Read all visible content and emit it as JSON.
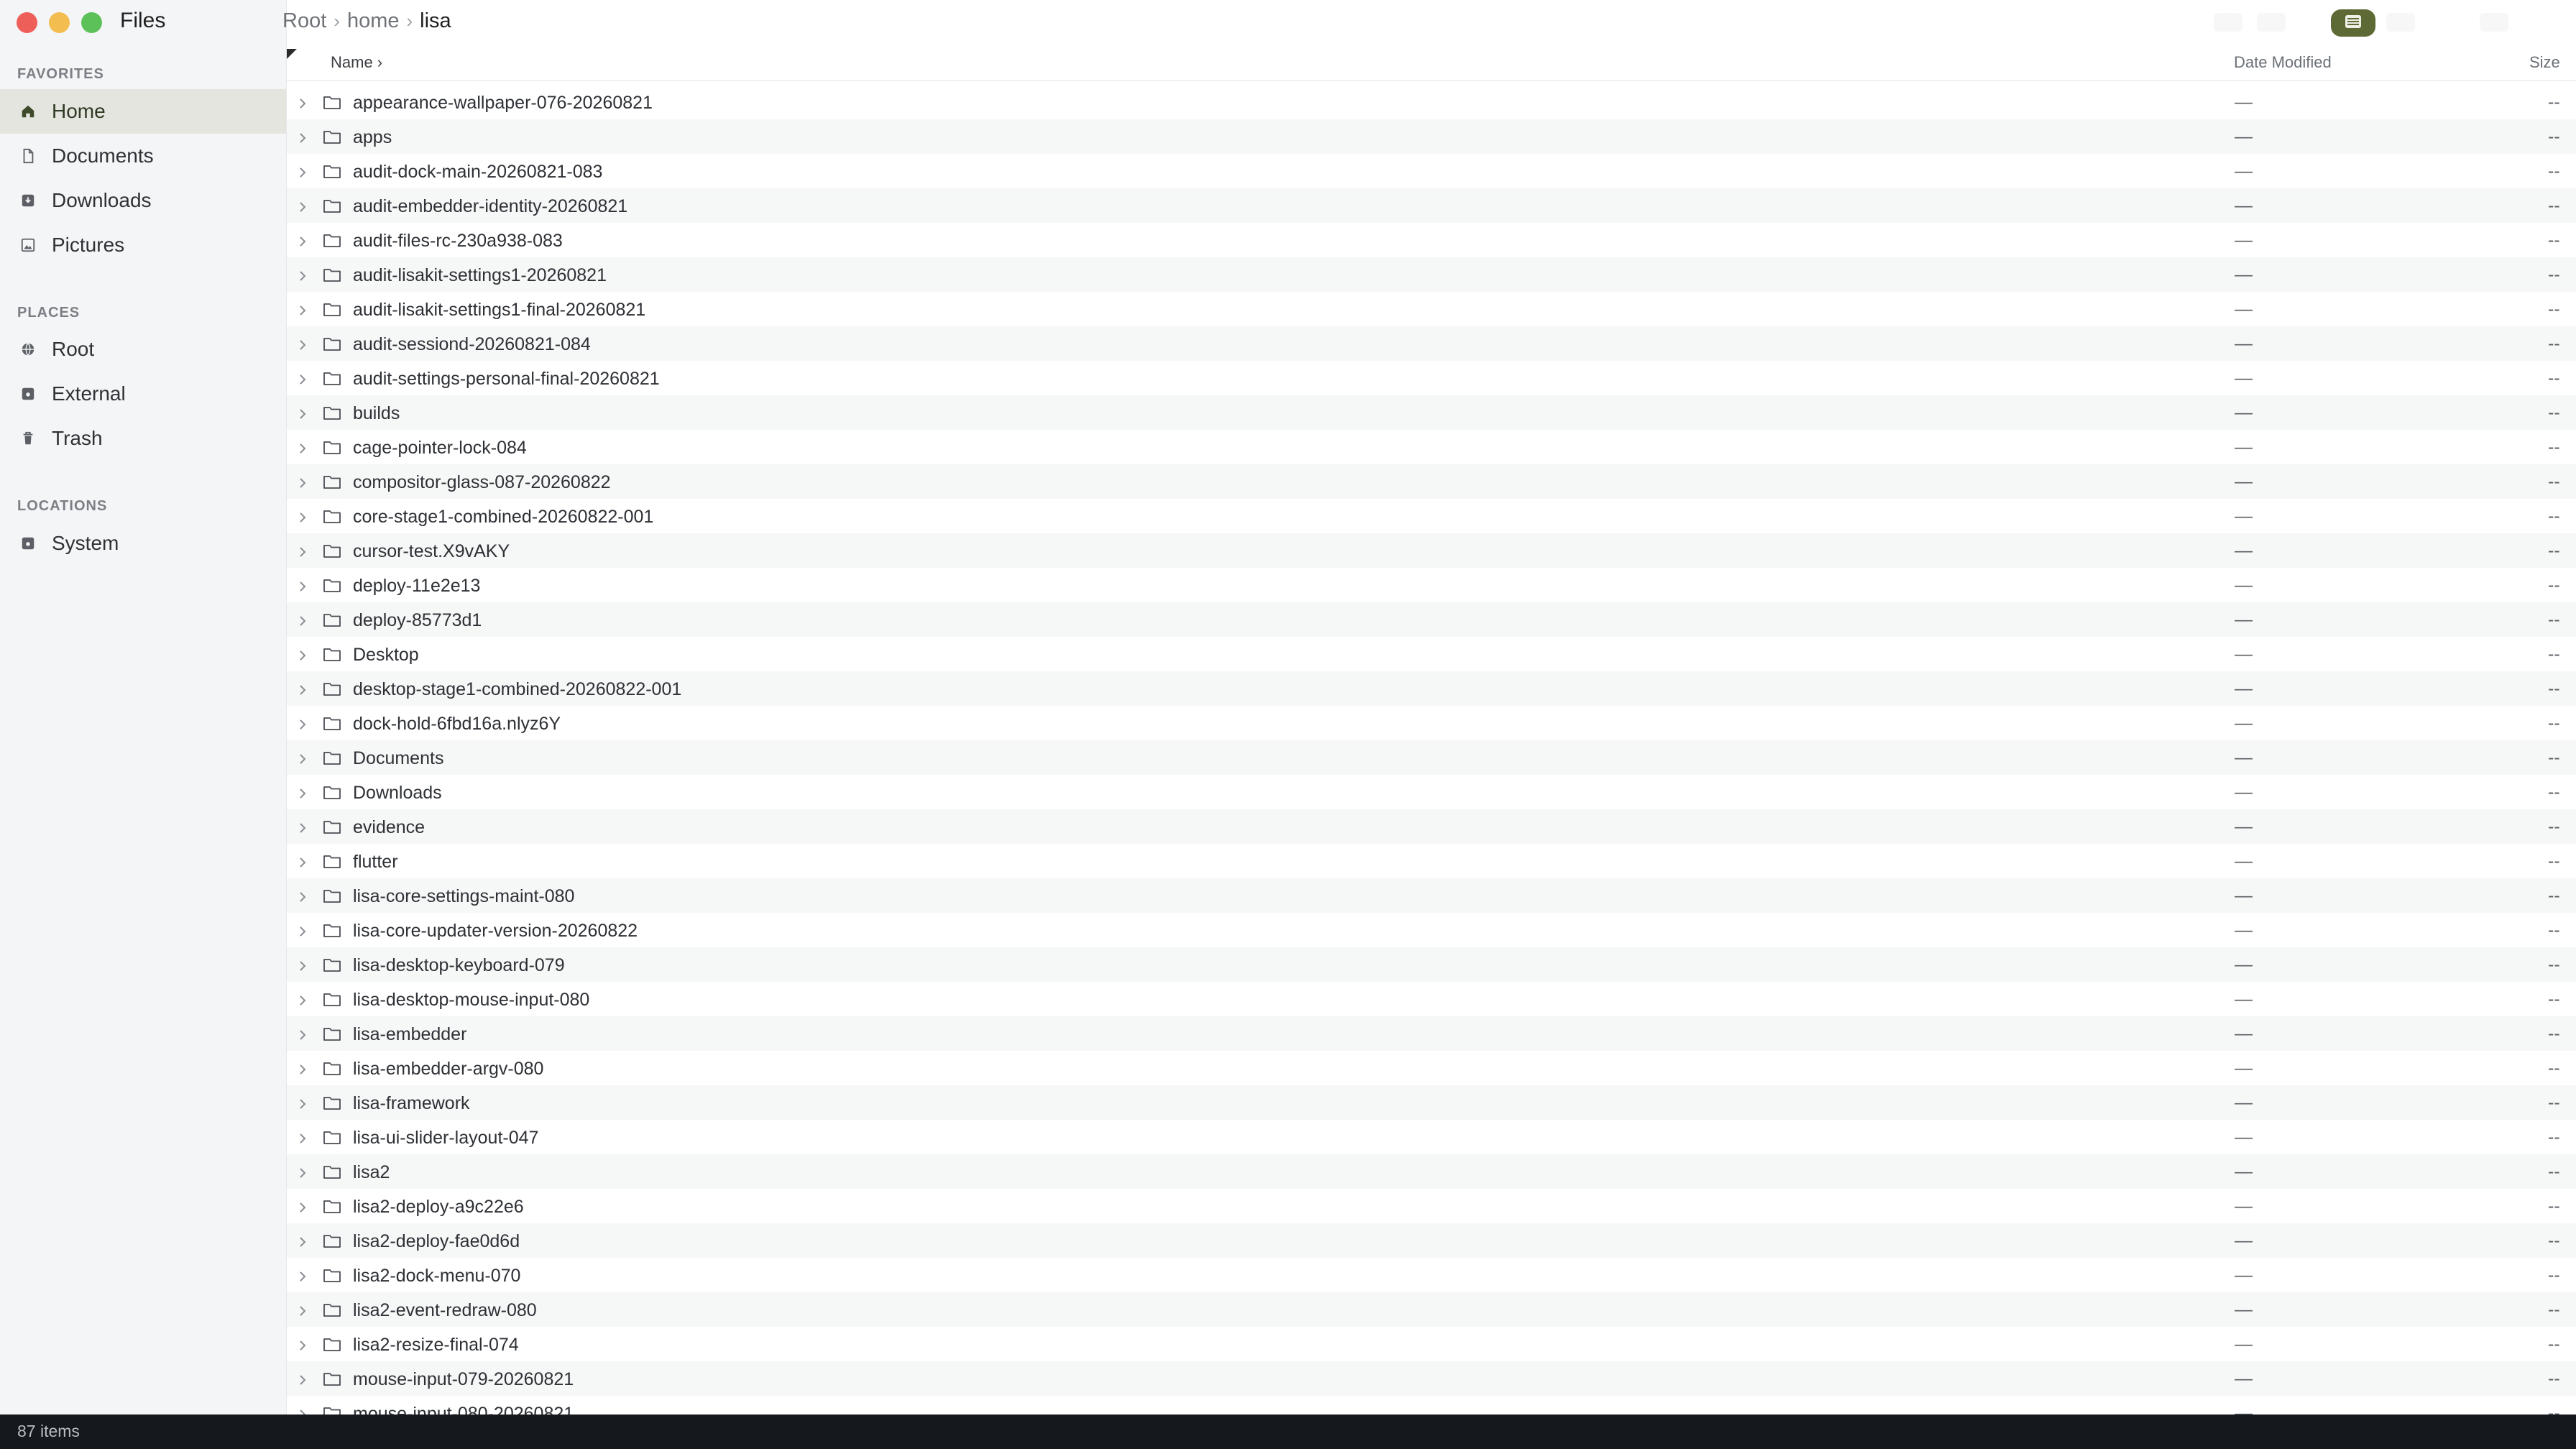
{
  "app": {
    "title": "Files"
  },
  "sidebar": {
    "sections": [
      {
        "label": "FAVORITES",
        "items": [
          {
            "label": "Home",
            "icon": "home-icon",
            "active": true
          },
          {
            "label": "Documents",
            "icon": "document-icon"
          },
          {
            "label": "Downloads",
            "icon": "downloads-icon"
          },
          {
            "label": "Pictures",
            "icon": "pictures-icon"
          }
        ]
      },
      {
        "label": "PLACES",
        "items": [
          {
            "label": "Root",
            "icon": "globe-icon"
          },
          {
            "label": "External",
            "icon": "drive-icon"
          },
          {
            "label": "Trash",
            "icon": "trash-icon"
          }
        ]
      },
      {
        "label": "LOCATIONS",
        "items": [
          {
            "label": "System",
            "icon": "drive-icon"
          }
        ]
      }
    ]
  },
  "breadcrumb": {
    "items": [
      "Root",
      "home",
      "lisa"
    ],
    "separator": "›"
  },
  "toolbar": {
    "view_icon": "list-view-icon",
    "accent": "#5d6a35"
  },
  "columns": {
    "name": "Name ›",
    "date": "Date Modified",
    "size": "Size"
  },
  "files": [
    {
      "name": "appearance-wallpaper-076-20260821",
      "date": "—",
      "size": "--"
    },
    {
      "name": "apps",
      "date": "—",
      "size": "--"
    },
    {
      "name": "audit-dock-main-20260821-083",
      "date": "—",
      "size": "--"
    },
    {
      "name": "audit-embedder-identity-20260821",
      "date": "—",
      "size": "--"
    },
    {
      "name": "audit-files-rc-230a938-083",
      "date": "—",
      "size": "--"
    },
    {
      "name": "audit-lisakit-settings1-20260821",
      "date": "—",
      "size": "--"
    },
    {
      "name": "audit-lisakit-settings1-final-20260821",
      "date": "—",
      "size": "--"
    },
    {
      "name": "audit-sessiond-20260821-084",
      "date": "—",
      "size": "--"
    },
    {
      "name": "audit-settings-personal-final-20260821",
      "date": "—",
      "size": "--"
    },
    {
      "name": "builds",
      "date": "—",
      "size": "--"
    },
    {
      "name": "cage-pointer-lock-084",
      "date": "—",
      "size": "--"
    },
    {
      "name": "compositor-glass-087-20260822",
      "date": "—",
      "size": "--"
    },
    {
      "name": "core-stage1-combined-20260822-001",
      "date": "—",
      "size": "--"
    },
    {
      "name": "cursor-test.X9vAKY",
      "date": "—",
      "size": "--"
    },
    {
      "name": "deploy-11e2e13",
      "date": "—",
      "size": "--"
    },
    {
      "name": "deploy-85773d1",
      "date": "—",
      "size": "--"
    },
    {
      "name": "Desktop",
      "date": "—",
      "size": "--"
    },
    {
      "name": "desktop-stage1-combined-20260822-001",
      "date": "—",
      "size": "--"
    },
    {
      "name": "dock-hold-6fbd16a.nlyz6Y",
      "date": "—",
      "size": "--"
    },
    {
      "name": "Documents",
      "date": "—",
      "size": "--"
    },
    {
      "name": "Downloads",
      "date": "—",
      "size": "--"
    },
    {
      "name": "evidence",
      "date": "—",
      "size": "--"
    },
    {
      "name": "flutter",
      "date": "—",
      "size": "--"
    },
    {
      "name": "lisa-core-settings-maint-080",
      "date": "—",
      "size": "--"
    },
    {
      "name": "lisa-core-updater-version-20260822",
      "date": "—",
      "size": "--"
    },
    {
      "name": "lisa-desktop-keyboard-079",
      "date": "—",
      "size": "--"
    },
    {
      "name": "lisa-desktop-mouse-input-080",
      "date": "—",
      "size": "--"
    },
    {
      "name": "lisa-embedder",
      "date": "—",
      "size": "--"
    },
    {
      "name": "lisa-embedder-argv-080",
      "date": "—",
      "size": "--"
    },
    {
      "name": "lisa-framework",
      "date": "—",
      "size": "--"
    },
    {
      "name": "lisa-ui-slider-layout-047",
      "date": "—",
      "size": "--"
    },
    {
      "name": "lisa2",
      "date": "—",
      "size": "--"
    },
    {
      "name": "lisa2-deploy-a9c22e6",
      "date": "—",
      "size": "--"
    },
    {
      "name": "lisa2-deploy-fae0d6d",
      "date": "—",
      "size": "--"
    },
    {
      "name": "lisa2-dock-menu-070",
      "date": "—",
      "size": "--"
    },
    {
      "name": "lisa2-event-redraw-080",
      "date": "—",
      "size": "--"
    },
    {
      "name": "lisa2-resize-final-074",
      "date": "—",
      "size": "--"
    },
    {
      "name": "mouse-input-079-20260821",
      "date": "—",
      "size": "--"
    },
    {
      "name": "mouse-input-080-20260821",
      "date": "—",
      "size": "--"
    }
  ],
  "status": {
    "item_count": "87 items"
  }
}
